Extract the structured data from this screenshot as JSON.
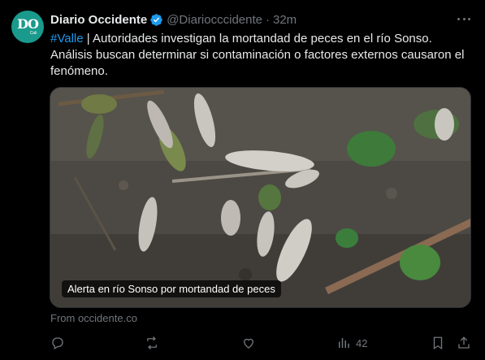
{
  "tweet": {
    "display_name": "Diario Occidente",
    "handle": "@Diariocccidente",
    "separator": "·",
    "time": "32m",
    "avatar": {
      "letters": "DO",
      "sub": "Cali",
      "color": "#1a9a8c"
    },
    "hashtag": "#Valle",
    "body": " | Autoridades investigan la mortandad de peces en el río Sonso. Análisis buscan determinar si contaminación o factores externos causaron el fenómeno.",
    "media": {
      "caption": "Alerta en río Sonso por mortandad de peces"
    },
    "source": "From occidente.co"
  },
  "actions": {
    "reply_icon": "reply-icon",
    "retweet_icon": "retweet-icon",
    "like_icon": "heart-icon",
    "views_icon": "views-icon",
    "views_count": "42",
    "bookmark_icon": "bookmark-icon",
    "share_icon": "share-icon"
  },
  "colors": {
    "background": "#000000",
    "text": "#e7e9ea",
    "muted": "#71767b",
    "accent": "#1d9bf0"
  }
}
